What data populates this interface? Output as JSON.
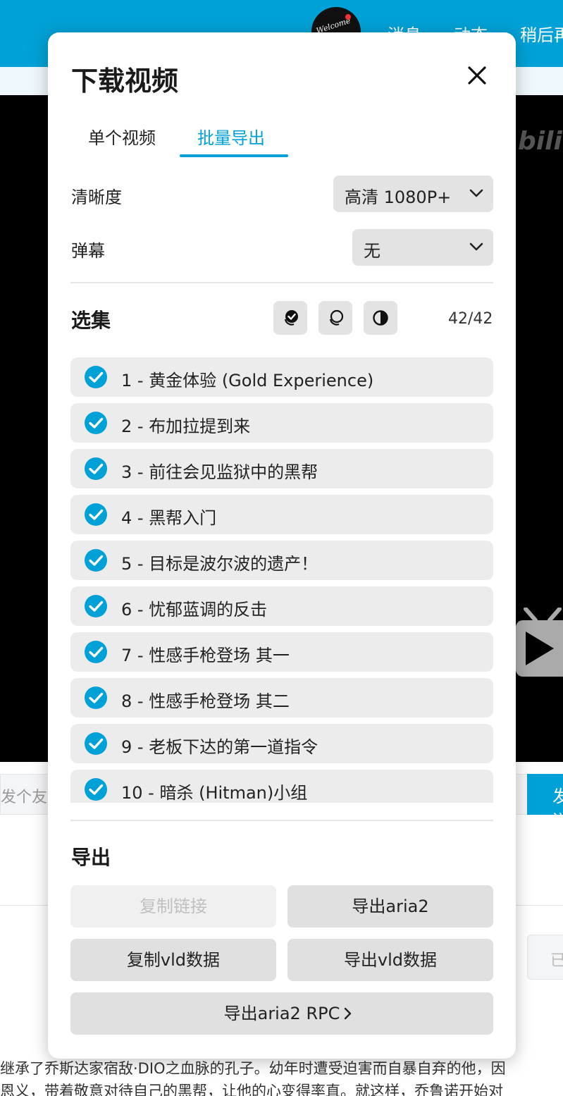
{
  "background": {
    "avatar_text": "Welcome",
    "nav": [
      "消息",
      "动态",
      "稍后再看"
    ],
    "watermark": "bili",
    "danmaku_placeholder": "发个友善的弹幕见证当下",
    "send_label": "发送",
    "side_button_label": "已",
    "description_lines": [
      "继承了乔斯达家宿敌·DIO之血脉的孔子。幼年时遭受迫害而自暴自弃的他，因",
      "恩义，带着敬意对待自己的黑帮，让他的心变得率直。就这样，乔鲁诺开始对"
    ]
  },
  "modal": {
    "title": "下载视频",
    "tabs": [
      {
        "label": "单个视频",
        "active": false
      },
      {
        "label": "批量导出",
        "active": true
      }
    ],
    "quality_label": "清晰度",
    "quality_value": "高清 1080P+",
    "danmaku_label": "弹幕",
    "danmaku_value": "无",
    "episodes_title": "选集",
    "selection_buttons": [
      "select-all-icon",
      "deselect-all-icon",
      "invert-selection-icon"
    ],
    "selected_count": "42/42",
    "episodes": [
      "1 - 黄金体验 (Gold Experience)",
      "2 - 布加拉提到来",
      "3 - 前往会见监狱中的黑帮",
      "4 - 黑帮入门",
      "5 - 目标是波尔波的遗产！",
      "6 - 忧郁蓝调的反击",
      "7 - 性感手枪登场 其一",
      "8 - 性感手枪登场 其二",
      "9 - 老板下达的第一道指令",
      "10 - 暗杀 (Hitman)小组"
    ],
    "export_title": "导出",
    "buttons": {
      "copy_link": "复制链接",
      "export_aria2": "导出aria2",
      "copy_vld": "复制vld数据",
      "export_vld": "导出vld数据",
      "export_aria2_rpc": "导出aria2 RPC"
    }
  },
  "colors": {
    "accent": "#00a1d6",
    "button_bg": "#e0e0e0",
    "item_bg": "#ececec"
  }
}
